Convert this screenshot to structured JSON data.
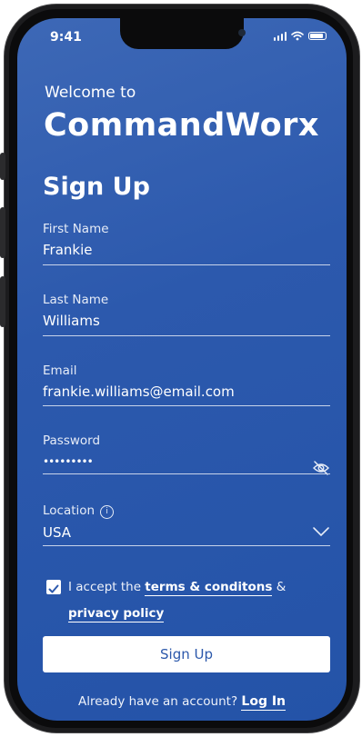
{
  "status_bar": {
    "time": "9:41"
  },
  "header": {
    "welcome": "Welcome to",
    "brand": "CommandWorx",
    "title": "Sign Up"
  },
  "form": {
    "first_name": {
      "label": "First Name",
      "value": "Frankie"
    },
    "last_name": {
      "label": "Last Name",
      "value": "Williams"
    },
    "email": {
      "label": "Email",
      "value": "frankie.williams@email.com"
    },
    "password": {
      "label": "Password",
      "value": "•••••••••"
    },
    "location": {
      "label": "Location",
      "value": "USA"
    }
  },
  "terms": {
    "checked": true,
    "prefix": "I accept the ",
    "terms_link": "terms & conditons",
    "and": " & ",
    "privacy_link": "privacy policy"
  },
  "signup_button": "Sign Up",
  "footer": {
    "prompt": "Already have an account?",
    "login_link": "Log In"
  },
  "colors": {
    "brand_blue": "#2c59ad",
    "background_top": "#3d68b6"
  },
  "icons": [
    "signal-icon",
    "wifi-icon",
    "battery-icon",
    "eye-slash-icon",
    "info-icon",
    "chevron-down-icon",
    "check-icon"
  ]
}
